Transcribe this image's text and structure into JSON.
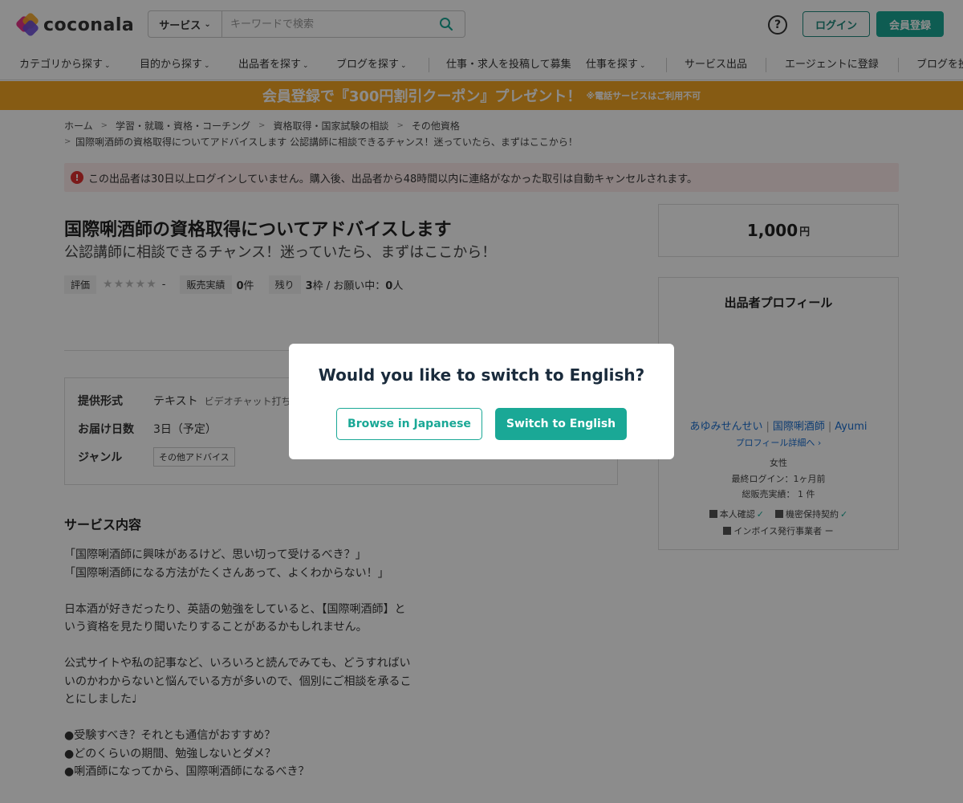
{
  "header": {
    "logo_text": "coconala",
    "search_category": "サービス",
    "search_placeholder": "キーワードで検索",
    "help": "?",
    "login": "ログイン",
    "signup": "会員登録"
  },
  "nav": {
    "items": [
      "カテゴリから探す",
      "目的から探す",
      "出品者を探す",
      "ブログを探す",
      "仕事・求人を投稿して募集",
      "仕事を探す",
      "サービス出品",
      "エージェントに登録",
      "ブログを投"
    ]
  },
  "banner": {
    "main": "会員登録で『300円割引クーポン』プレゼント！",
    "note": "※電話サービスはご利用不可"
  },
  "breadcrumb": {
    "items": [
      "ホーム",
      "学習・就職・資格・コーチング",
      "資格取得・国家試験の相談",
      "その他資格"
    ],
    "current": "国際唎酒師の資格取得についてアドバイスします 公認講師に相談できるチャンス！迷っていたら、まずはここから！"
  },
  "alert": {
    "icon": "!",
    "text": "この出品者は30日以上ログインしていません。購入後、出品者から48時間以内に連絡がなかった取引は自動キャンセルされます。"
  },
  "service": {
    "title": "国際唎酒師の資格取得についてアドバイスします",
    "subtitle": "公認講師に相談できるチャンス！迷っていたら、まずはここから！"
  },
  "stats": {
    "rating_label": "評価",
    "rating_value": 0,
    "rating_text": "-",
    "sales_label": "販売実績",
    "sales_count": "0",
    "sales_unit": "件",
    "remaining_label": "残り",
    "remaining_count": "3",
    "remaining_unit": "枠 / お願い中：",
    "requesting_count": "0",
    "requesting_unit": "人"
  },
  "info": {
    "format_label": "提供形式",
    "format_value": "テキスト",
    "format_sub": "ビデオチャット打ち",
    "delivery_label": "お届け日数",
    "delivery_value": "3日（予定）",
    "genre_label": "ジャンル",
    "genre_tag": "その他アドバイス"
  },
  "description": {
    "section_title": "サービス内容",
    "paragraphs": [
      "「国際唎酒師に興味があるけど、思い切って受けるべき？」\n「国際唎酒師になる方法がたくさんあって、よくわからない！」",
      "日本酒が好きだったり、英語の勉強をしていると、【国際唎酒師】と\nいう資格を見たり聞いたりすることがあるかもしれません。",
      "公式サイトや私の記事など、いろいろと読んでみても、どうすればい\nいのかわからないと悩んでいる方が多いので、個別にご相談を承るこ\nとにしました♩",
      "●受験すべき？それとも通信がおすすめ？\n●どのくらいの期間、勉強しないとダメ？\n●唎酒師になってから、国際唎酒師になるべき？"
    ]
  },
  "price": {
    "amount": "1,000",
    "unit": "円"
  },
  "profile": {
    "title": "出品者プロフィール",
    "names": [
      "あゆみせんせい",
      "国際唎酒師",
      "Ayumi"
    ],
    "detail_link": "プロフィール詳細へ ›",
    "gender": "女性",
    "last_login": "最終ログイン：1ヶ月前",
    "total_sales": "総販売実績： 1 件",
    "badge_identity": "本人確認",
    "badge_nda": "機密保持契約",
    "badge_invoice": "インボイス発行事業者",
    "badge_invoice_status": "ー",
    "check": "✓"
  },
  "modal": {
    "title": "Would you like to switch to English?",
    "browse_japanese": "Browse in Japanese",
    "switch_english": "Switch to English"
  },
  "colors": {
    "accent": "#1aa896",
    "banner": "#f5a623",
    "alert_bg": "#fdecec",
    "link": "#1a6fd1"
  }
}
